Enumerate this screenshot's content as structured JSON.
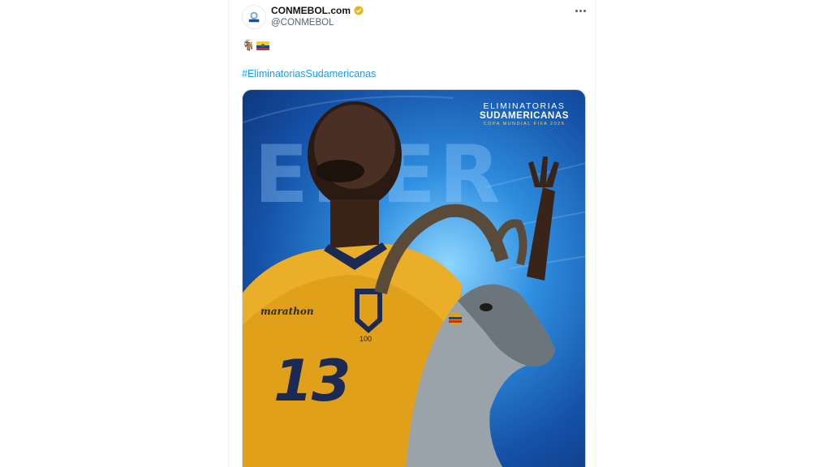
{
  "author": {
    "display_name": "CONMEBOL.com",
    "handle": "@CONMEBOL",
    "verified": true,
    "avatar_icon": "conmebol-logo-icon"
  },
  "more_icon": "more-horizontal-icon",
  "tweet": {
    "emoji_goat": "🐐",
    "emoji_flag": "ecuador-flag-icon",
    "hashtag": "#EliminatoriasSudamericanas"
  },
  "media": {
    "brand_line1": "ELIMINATORIAS",
    "brand_line2": "SUDAMERICANAS",
    "brand_line3": "COPA MUNDIAL FIFA 2026",
    "background_text": "ENER",
    "sponsor": "marathon",
    "jersey_number": "13",
    "crest_number": "100"
  },
  "colors": {
    "link": "#1d9bf0",
    "verified_badge": "#e2b719",
    "jersey": "#e0a01a"
  }
}
